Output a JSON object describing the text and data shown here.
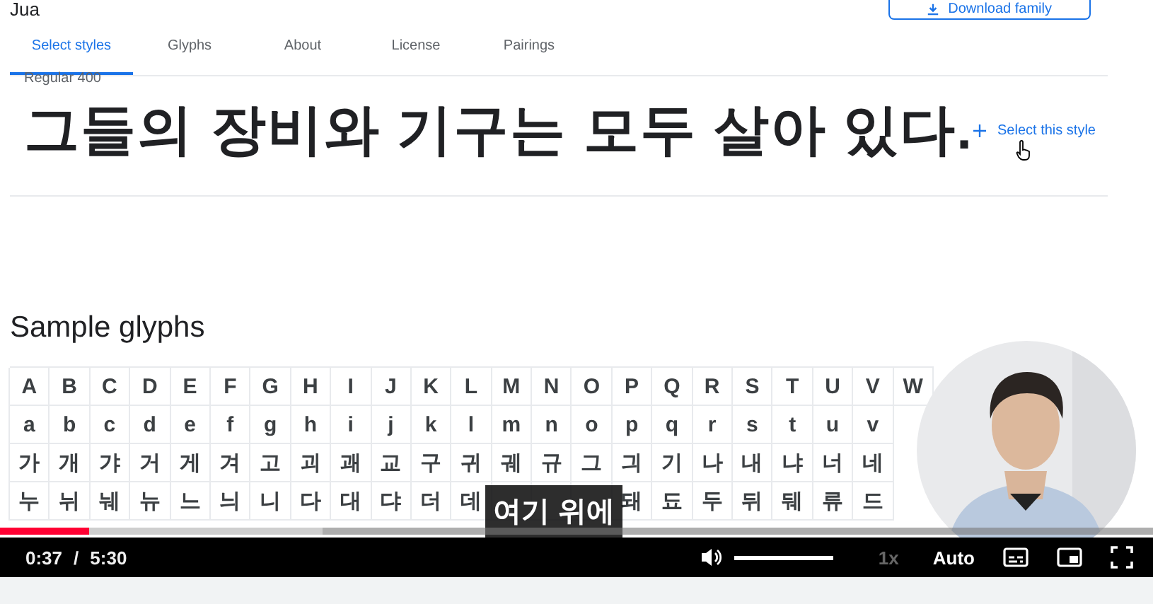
{
  "page": {
    "title": "Jua",
    "download_button": "Download family",
    "tabs": [
      {
        "label": "Select styles",
        "selected": true
      },
      {
        "label": "Glyphs",
        "selected": false
      },
      {
        "label": "About",
        "selected": false
      },
      {
        "label": "License",
        "selected": false
      },
      {
        "label": "Pairings",
        "selected": false
      }
    ],
    "style_name": "Regular 400",
    "sample_text": "그들의 장비와 기구는 모두 살아 있다.",
    "select_style": "Select this style",
    "section_title": "Sample glyphs",
    "glyph_rows": [
      [
        "A",
        "B",
        "C",
        "D",
        "E",
        "F",
        "G",
        "H",
        "I",
        "J",
        "K",
        "L",
        "M",
        "N",
        "O",
        "P",
        "Q",
        "R",
        "S",
        "T",
        "U",
        "V",
        "W"
      ],
      [
        "a",
        "b",
        "c",
        "d",
        "e",
        "f",
        "g",
        "h",
        "i",
        "j",
        "k",
        "l",
        "m",
        "n",
        "o",
        "p",
        "q",
        "r",
        "s",
        "t",
        "u",
        "v"
      ],
      [
        "가",
        "개",
        "갸",
        "거",
        "게",
        "겨",
        "고",
        "괴",
        "괘",
        "교",
        "구",
        "귀",
        "궤",
        "규",
        "그",
        "긔",
        "기",
        "나",
        "내",
        "냐",
        "너",
        "네"
      ],
      [
        "누",
        "뉘",
        "눼",
        "뉴",
        "느",
        "늬",
        "니",
        "다",
        "대",
        "댜",
        "더",
        "데",
        null,
        null,
        null,
        "돼",
        "됴",
        "두",
        "뒤",
        "뒈",
        "류",
        "드"
      ]
    ]
  },
  "caption": "여기 위에",
  "player": {
    "progress": {
      "level": 0.077
    },
    "buffer": {
      "level": 0.28
    },
    "current_time": "0:37",
    "separator": "/",
    "duration": "5:30",
    "volume": {
      "level": 1
    },
    "speed": {
      "label": "1x",
      "disabled": true
    },
    "quality": "Auto"
  }
}
